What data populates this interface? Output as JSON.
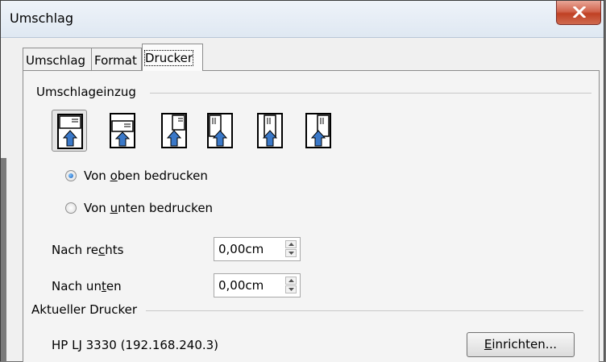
{
  "window": {
    "title": "Umschlag"
  },
  "tabs": [
    {
      "label": "Umschlag"
    },
    {
      "label": "Format"
    },
    {
      "label": "Drucker",
      "active": true
    }
  ],
  "feed_section": {
    "title": "Umschlageinzug",
    "options": [
      {
        "icon": "feed-horizontal-left-icon",
        "selected": true
      },
      {
        "icon": "feed-horizontal-center-icon",
        "selected": false
      },
      {
        "icon": "feed-horizontal-right-icon",
        "selected": false
      },
      {
        "icon": "feed-vertical-left-icon",
        "selected": false
      },
      {
        "icon": "feed-vertical-center-icon",
        "selected": false
      },
      {
        "icon": "feed-vertical-right-icon",
        "selected": false
      }
    ]
  },
  "print_side": {
    "options": [
      {
        "label": "Von oben bedrucken",
        "selected": true
      },
      {
        "label": "Von unten bedrucken",
        "selected": false
      }
    ]
  },
  "shift": {
    "right_label": "Nach rechts",
    "right_value": "0,00cm",
    "down_label": "Nach unten",
    "down_value": "0,00cm"
  },
  "printer": {
    "title": "Aktueller Drucker",
    "name": "HP LJ 3330 (192.168.240.3)",
    "setup_button": "Einrichten..."
  },
  "colors": {
    "window_bg": "#f0f0f0",
    "close_button": "#c75a42",
    "arrow_blue": "#3a78c8"
  }
}
